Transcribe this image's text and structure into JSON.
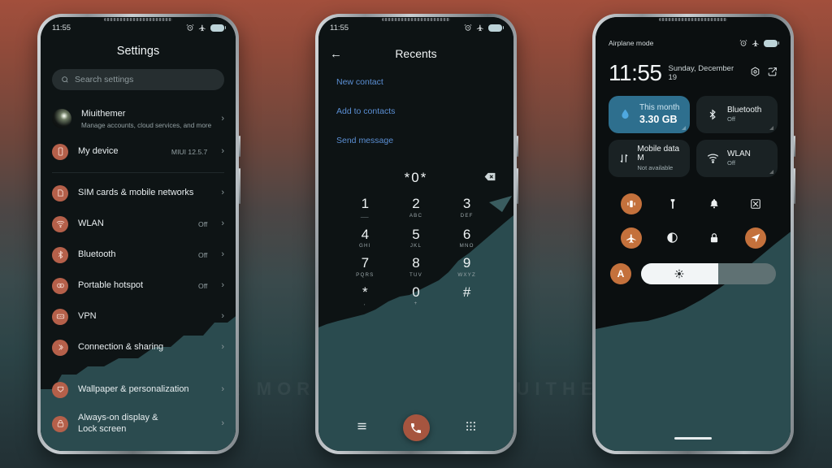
{
  "watermark": "VISIT FOR MORE THEMES - MIUITHEMER.COM",
  "theme": {
    "accent_orange": "#c4713c",
    "accent_brick": "#b5604a",
    "tile_active_blue": "#2e6f8e",
    "link_blue": "#5b8fd4",
    "screen_bg": "#0d1314",
    "wallpaper_teal": "#2a4c50"
  },
  "phone1": {
    "statusbar": {
      "time": "11:55",
      "icons": [
        "alarm-icon",
        "airplane-icon",
        "battery-icon"
      ]
    },
    "title": "Settings",
    "search": {
      "placeholder": "Search settings",
      "icon": "search-icon"
    },
    "account": {
      "name": "Miuithemer",
      "subtitle": "Manage accounts, cloud services, and more",
      "chevron": "›"
    },
    "items": [
      {
        "label": "My device",
        "value": "MIUI 12.5.7",
        "icon": "device-icon",
        "chevron": "›"
      },
      {
        "label": "SIM cards & mobile networks",
        "value": "",
        "icon": "sim-icon",
        "chevron": "›"
      },
      {
        "label": "WLAN",
        "value": "Off",
        "icon": "wifi-icon",
        "chevron": "›"
      },
      {
        "label": "Bluetooth",
        "value": "Off",
        "icon": "bluetooth-icon",
        "chevron": "›"
      },
      {
        "label": "Portable hotspot",
        "value": "Off",
        "icon": "hotspot-icon",
        "chevron": "›"
      },
      {
        "label": "VPN",
        "value": "",
        "icon": "vpn-icon",
        "chevron": "›"
      },
      {
        "label": "Connection & sharing",
        "value": "",
        "icon": "share-icon",
        "chevron": "›"
      },
      {
        "label": "Wallpaper & personalization",
        "value": "",
        "icon": "wallpaper-icon",
        "chevron": "›"
      },
      {
        "label": "Always-on display & Lock screen",
        "value": "",
        "icon": "lock-icon",
        "chevron": "›"
      }
    ]
  },
  "phone2": {
    "statusbar": {
      "time": "11:55",
      "icons": [
        "alarm-icon",
        "airplane-icon",
        "battery-icon"
      ]
    },
    "title": "Recents",
    "back_icon": "arrow-left-icon",
    "links": [
      "New contact",
      "Add to contacts",
      "Send message"
    ],
    "dialed_number": "*0*",
    "delete_icon": "backspace-icon",
    "keys": [
      {
        "digit": "1",
        "letters": "⸺"
      },
      {
        "digit": "2",
        "letters": "ABC"
      },
      {
        "digit": "3",
        "letters": "DEF"
      },
      {
        "digit": "4",
        "letters": "GHI"
      },
      {
        "digit": "5",
        "letters": "JKL"
      },
      {
        "digit": "6",
        "letters": "MNO"
      },
      {
        "digit": "7",
        "letters": "PQRS"
      },
      {
        "digit": "8",
        "letters": "TUV"
      },
      {
        "digit": "9",
        "letters": "WXYZ"
      },
      {
        "digit": "*",
        "letters": ","
      },
      {
        "digit": "0",
        "letters": "+"
      },
      {
        "digit": "#",
        "letters": ""
      }
    ],
    "bottom_bar": {
      "menu_icon": "menu-icon",
      "call_icon": "phone-call-icon",
      "keypad_icon": "dialpad-icon"
    }
  },
  "phone3": {
    "statusbar": {
      "label": "Airplane mode",
      "icons": [
        "alarm-icon",
        "airplane-icon",
        "battery-icon"
      ]
    },
    "clock": "11:55",
    "date": "Sunday, December 19",
    "header_icons": [
      "settings-gear-icon",
      "edit-icon"
    ],
    "tiles": [
      {
        "line1": "This month",
        "line2": "3.30 GB",
        "icon": "data-usage-drop-icon",
        "active": true
      },
      {
        "line1": "Bluetooth",
        "line2": "Off",
        "icon": "bluetooth-icon",
        "active": false
      },
      {
        "line1": "Mobile data  M",
        "line2": "Not available",
        "icon": "data-transfer-icon",
        "active": false
      },
      {
        "line1": "WLAN",
        "line2": "Off",
        "icon": "wifi-icon",
        "active": false
      }
    ],
    "toggles": [
      {
        "name": "vibrate-icon",
        "on": true
      },
      {
        "name": "flashlight-icon",
        "on": false
      },
      {
        "name": "bell-icon",
        "on": false
      },
      {
        "name": "screenshot-icon",
        "on": false
      },
      {
        "name": "airplane-icon",
        "on": true
      },
      {
        "name": "dark-mode-icon",
        "on": false
      },
      {
        "name": "lock-icon",
        "on": false
      },
      {
        "name": "location-icon",
        "on": true
      }
    ],
    "auto_brightness": {
      "label": "A",
      "on": true
    },
    "brightness": {
      "icon": "sun-icon",
      "percent": 57
    }
  }
}
